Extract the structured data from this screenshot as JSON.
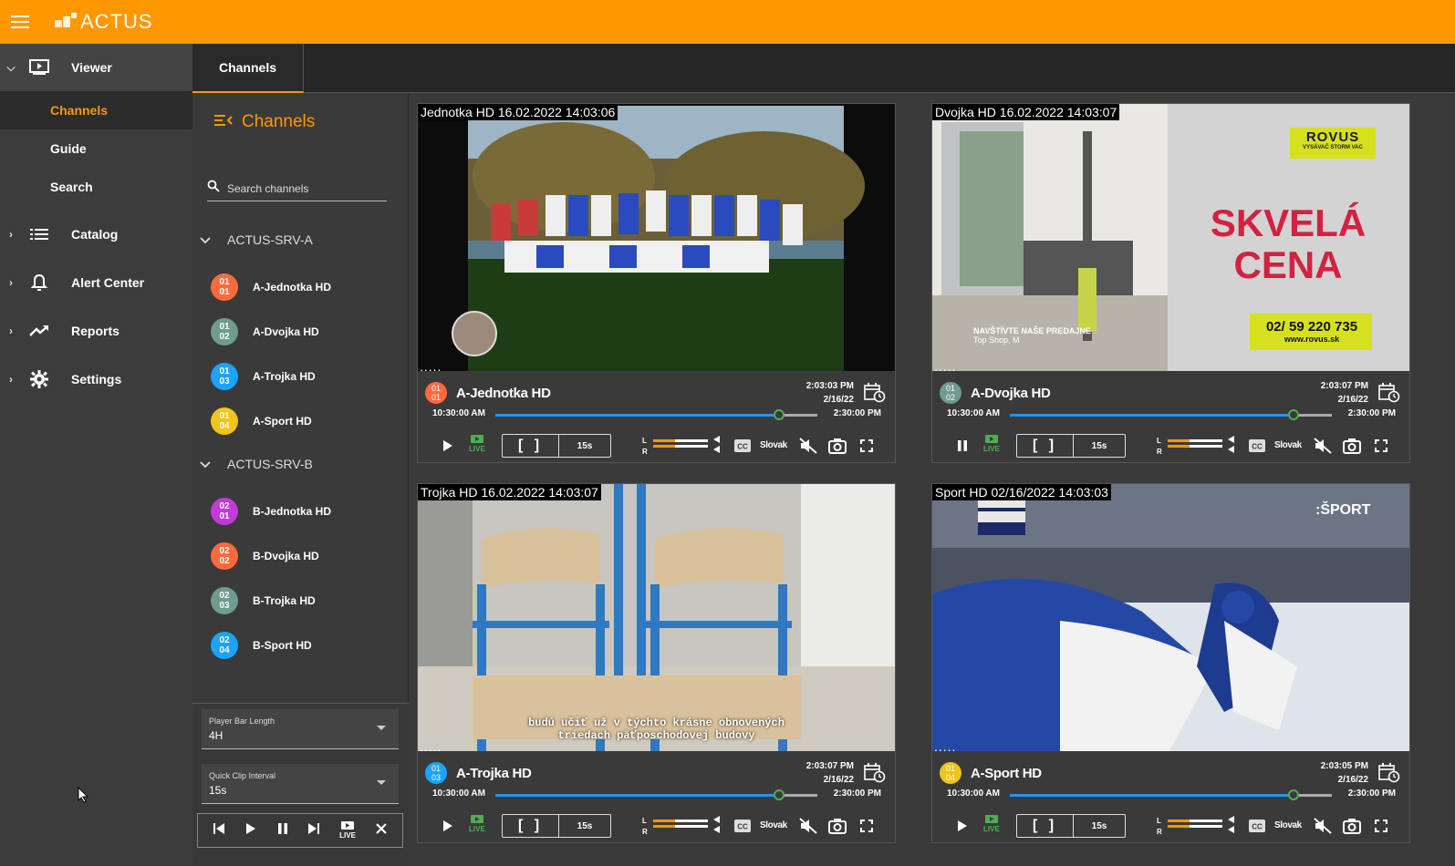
{
  "app": {
    "name": "ACTUS"
  },
  "colors": {
    "accent": "#ff9800",
    "progress": "#2196f3",
    "live": "#4caf50"
  },
  "nav": {
    "viewer": "Viewer",
    "sub": [
      "Channels",
      "Guide",
      "Search"
    ],
    "items": [
      "Catalog",
      "Alert Center",
      "Reports",
      "Settings"
    ]
  },
  "tab": "Channels",
  "panel": {
    "title": "Channels",
    "search_placeholder": "Search channels",
    "groups": [
      {
        "name": "ACTUS-SRV-A",
        "channels": [
          {
            "a": "01",
            "b": "01",
            "name": "A-Jednotka HD",
            "color": "#ff6a3d"
          },
          {
            "a": "01",
            "b": "02",
            "name": "A-Dvojka HD",
            "color": "#6e9c8e"
          },
          {
            "a": "01",
            "b": "03",
            "name": "A-Trojka HD",
            "color": "#1aa3ff"
          },
          {
            "a": "01",
            "b": "04",
            "name": "A-Sport HD",
            "color": "#f0c419"
          }
        ]
      },
      {
        "name": "ACTUS-SRV-B",
        "channels": [
          {
            "a": "02",
            "b": "01",
            "name": "B-Jednotka HD",
            "color": "#c23ad9"
          },
          {
            "a": "02",
            "b": "02",
            "name": "B-Dvojka HD",
            "color": "#ff6a3d"
          },
          {
            "a": "02",
            "b": "03",
            "name": "B-Trojka HD",
            "color": "#6e9c8e"
          },
          {
            "a": "02",
            "b": "04",
            "name": "B-Sport HD",
            "color": "#1aa3ff"
          }
        ]
      }
    ],
    "bar_length": {
      "label": "Player Bar Length",
      "value": "4H"
    },
    "clip_interval": {
      "label": "Quick Clip Interval",
      "value": "15s"
    }
  },
  "players": [
    {
      "osd": "Jednotka HD  16.02.2022 14:03:06",
      "name": "A-Jednotka HD",
      "a": "01",
      "b": "01",
      "color": "#ff6a3d",
      "time": "2:03:03 PM",
      "date": "2/16/22",
      "start": "10:30:00 AM",
      "end": "2:30:00 PM",
      "progress": 0.88,
      "playing": false,
      "clip": "[ ]",
      "quick": "15s",
      "lang": "Slovak",
      "live": "LIVE"
    },
    {
      "osd": "Dvojka HD  16.02.2022 14:03:07",
      "name": "A-Dvojka HD",
      "a": "01",
      "b": "02",
      "color": "#6e9c8e",
      "time": "2:03:07 PM",
      "date": "2/16/22",
      "start": "10:30:00 AM",
      "end": "2:30:00 PM",
      "progress": 0.88,
      "playing": true,
      "clip": "[ ]",
      "quick": "15s",
      "lang": "Slovak",
      "live": "LIVE",
      "overlay": {
        "brand": "ROVUS",
        "sub": "VYSÁVAČ STORM VAC",
        "headline1": "SKVELÁ",
        "headline2": "CENA",
        "phone": "02/ 59 220 735",
        "web": "www.rovus.sk",
        "visit": "NAVŠTÍVTE NAŠE PREDAJNE",
        "shop": "Top Shop, M"
      }
    },
    {
      "osd": "Trojka HD  16.02.2022 14:03:07",
      "name": "A-Trojka HD",
      "a": "01",
      "b": "03",
      "color": "#1aa3ff",
      "time": "2:03:07 PM",
      "date": "2/16/22",
      "start": "10:30:00 AM",
      "end": "2:30:00 PM",
      "progress": 0.88,
      "playing": false,
      "clip": "[ ]",
      "quick": "15s",
      "lang": "Slovak",
      "live": "LIVE",
      "subtitle1": "budú učiť už v týchto krásne obnovených",
      "subtitle2": "triedach päťposchodovej budovy"
    },
    {
      "osd": "Sport HD  02/16/2022 14:03:03",
      "name": "A-Sport HD",
      "a": "01",
      "b": "04",
      "color": "#f0c419",
      "time": "2:03:05 PM",
      "date": "2/16/22",
      "start": "10:30:00 AM",
      "end": "2:30:00 PM",
      "progress": 0.88,
      "playing": false,
      "clip": "[ ]",
      "quick": "15s",
      "lang": "Slovak",
      "live": "LIVE",
      "logo": ":ŠPORT"
    }
  ],
  "transport_live": "LIVE"
}
